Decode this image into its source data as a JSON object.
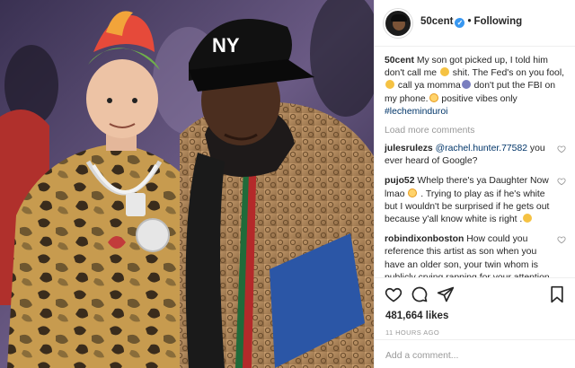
{
  "post": {
    "username": "50cent",
    "follow_state": "Following",
    "caption_user": "50cent",
    "caption_text": " My son got picked up, I told him don't call me ",
    "caption_text_2": " shit. The Fed's on you fool,",
    "caption_text_3": " call ya momma",
    "caption_text_4": " don't put the FBI on my phone.",
    "caption_text_5": " positive vibes only ",
    "hashtag": "#lecheminduroi",
    "load_more": "Load more comments",
    "likes": "481,664 likes",
    "timestamp": "11 HOURS AGO",
    "add_comment_placeholder": "Add a comment..."
  },
  "comments": [
    {
      "user": "julesrulezs",
      "mention": "@rachel.hunter.77582",
      "text": " you ever heard of Google?"
    },
    {
      "user": "pujo52",
      "text": " Whelp there's ya Daughter Now lmao ",
      "text_2": " . Trying to play as if he's white but I wouldn't be surprised if he gets out because y'all know white is right ."
    },
    {
      "user": "robindixonboston",
      "text": " How could you reference this artist as son when you have an older son, your twin whom is publicly crying rapping for your attention and love. No matter the"
    }
  ],
  "icons": {
    "verified": "verified-badge-icon",
    "heart": "heart-icon",
    "comment": "comment-icon",
    "share": "share-icon",
    "save": "bookmark-icon"
  },
  "colors": {
    "link": "#003569",
    "verified": "#3897f0",
    "muted": "#999999"
  }
}
